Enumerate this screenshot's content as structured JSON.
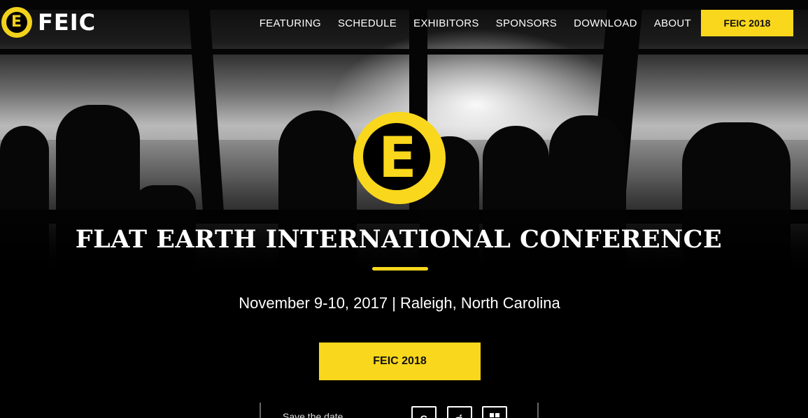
{
  "brand": {
    "name": "FEIC",
    "logo_letter": "E"
  },
  "nav": {
    "items": [
      "FEATURING",
      "SCHEDULE",
      "EXHIBITORS",
      "SPONSORS",
      "DOWNLOAD",
      "ABOUT"
    ],
    "cta": "FEIC 2018"
  },
  "hero": {
    "emblem_letter": "E",
    "title": "FLAT EARTH INTERNATIONAL CONFERENCE",
    "subtitle": "November 9-10, 2017 | Raleigh, North Carolina",
    "cta": "FEIC 2018"
  },
  "save_date": {
    "label": "Save the date",
    "calendars": [
      {
        "icon": "google-icon",
        "glyph": "G"
      },
      {
        "icon": "apple-icon",
        "glyph": ""
      },
      {
        "icon": "windows-icon",
        "glyph": "⊞"
      }
    ]
  },
  "colors": {
    "accent": "#f9d71c",
    "background": "#000000",
    "text": "#ffffff"
  }
}
